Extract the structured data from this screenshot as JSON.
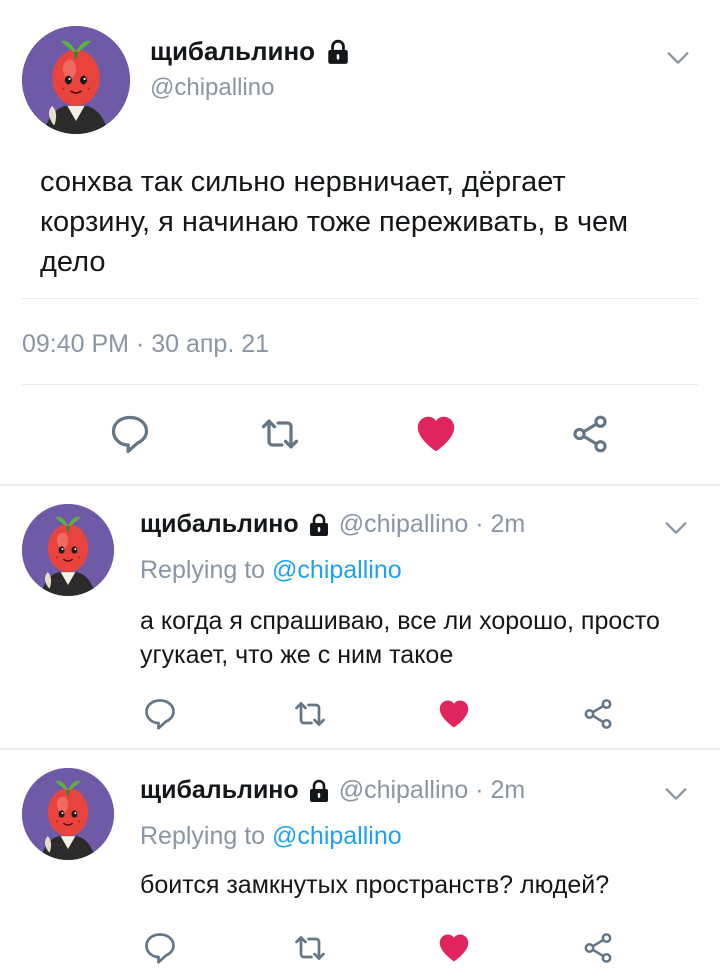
{
  "colors": {
    "accent": "#1da1f2",
    "text": "#14171a",
    "muted": "#8a96a3",
    "like": "#e0245e",
    "divider": "#e6ecf0"
  },
  "main_tweet": {
    "display_name": "щибальлино",
    "handle": "@chipallino",
    "text": "сонхва так сильно нервничает, дёргает корзину, я начинаю тоже переживать, в чем дело",
    "timestamp": "09:40 PM · 30 апр. 21",
    "actions": [
      "reply-icon",
      "retweet-icon",
      "like-icon-filled",
      "share-icon"
    ]
  },
  "replies": [
    {
      "display_name": "щибальлино",
      "handle_time": "@chipallino · 2m",
      "replying_prefix": "Replying to",
      "replying_to": "@chipallino",
      "text": "а когда я спрашиваю, все ли хорошо, просто угукает, что же с ним такое"
    },
    {
      "display_name": "щибальлино",
      "handle_time": "@chipallino · 2m",
      "replying_prefix": "Replying to",
      "replying_to": "@chipallino",
      "text": "боится замкнутых пространств? людей?"
    }
  ]
}
